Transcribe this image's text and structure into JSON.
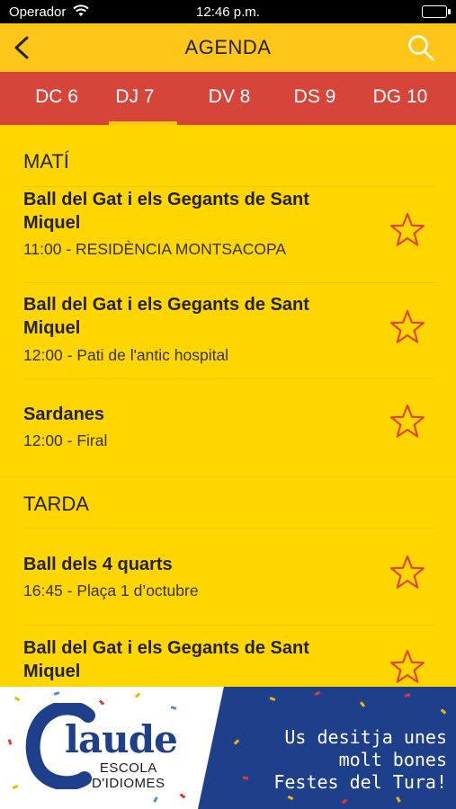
{
  "status_bar": {
    "carrier": "Operador",
    "time": "12:46 p.m."
  },
  "nav": {
    "title": "AGENDA",
    "back_icon": "chevron-left-icon",
    "search_icon": "search-icon"
  },
  "day_tabs": [
    {
      "label": "DC 6"
    },
    {
      "label": "DJ 7",
      "active": true
    },
    {
      "label": "DV 8"
    },
    {
      "label": "DS 9"
    },
    {
      "label": "DG 10"
    }
  ],
  "sections": [
    {
      "header": "MATÍ",
      "events": [
        {
          "title": "Ball del Gat i els Gegants de Sant Miquel",
          "subtitle": "11:00 - RESIDÈNCIA MONTSACOPA"
        },
        {
          "title": "Ball del Gat i els Gegants de Sant Miquel",
          "subtitle": "12:00 - Pati de l'antic hospital"
        },
        {
          "title": "Sardanes",
          "subtitle": "12:00 - Firal"
        }
      ]
    },
    {
      "header": "TARDA",
      "events": [
        {
          "title": "Ball dels 4 quarts",
          "subtitle": "16:45 - Plaça 1 d’octubre"
        },
        {
          "title": "Ball del Gat i els Gegants de Sant Miquel",
          "subtitle": ""
        }
      ]
    }
  ],
  "ad": {
    "brand": "laude",
    "school_line1": "ESCOLA",
    "school_line2": "D'IDIOMES",
    "message_line1": "Us desitja unes",
    "message_line2": "molt bones",
    "message_line3": "Festes del Tura!"
  },
  "colors": {
    "yellow": "#FFD600",
    "nav_yellow": "#FFC61A",
    "tab_red": "#D6453A",
    "star_red": "#E53935",
    "ad_blue": "#1E3F8A"
  }
}
